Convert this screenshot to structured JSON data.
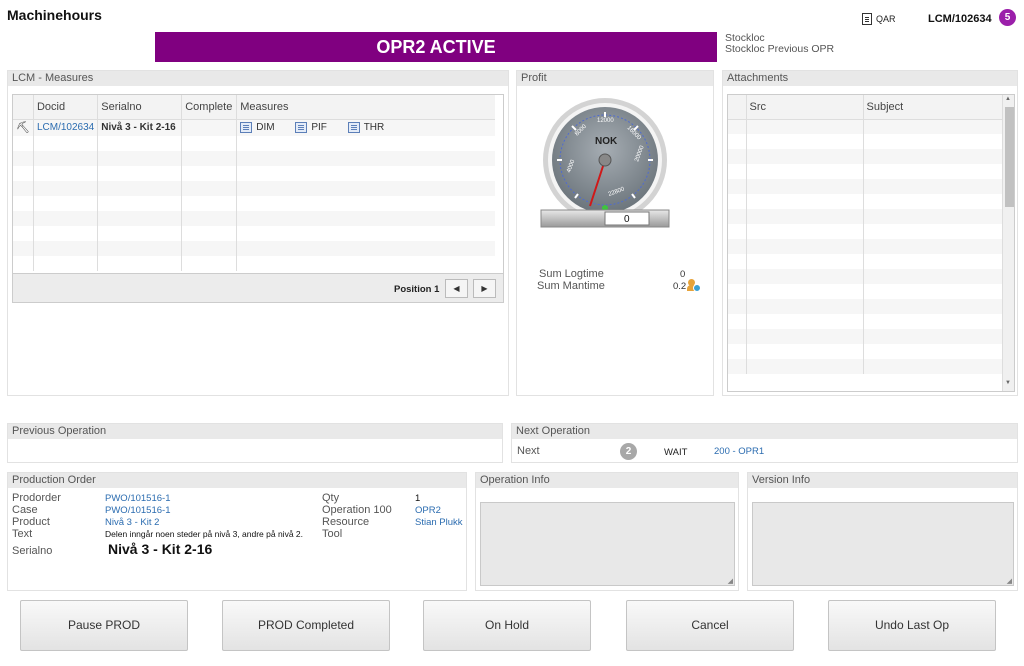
{
  "header": {
    "title": "Machinehours",
    "status_banner": "OPR2 ACTIVE",
    "banner_color": "#800080",
    "stockloc_label": "Stockloc",
    "stockloc_prev_label": "Stockloc Previous OPR",
    "qar_label": "QAR",
    "lcm_id": "LCM/102634",
    "lcm_badge": "5"
  },
  "lcm_measures": {
    "title": "LCM - Measures",
    "columns": [
      "Docid",
      "Serialno",
      "Complete",
      "Measures"
    ],
    "row": {
      "docid": "LCM/102634",
      "serialno": "Nivå 3 - Kit 2-16",
      "complete": "",
      "measures": [
        "DIM",
        "PIF",
        "THR"
      ]
    },
    "position_label": "Position 1",
    "prev_icon": "triangle-left",
    "next_icon": "triangle-right"
  },
  "profit": {
    "title": "Profit",
    "gauge_unit": "NOK",
    "gauge_ticks": [
      "4000",
      "8000",
      "12000",
      "16000",
      "20000",
      "22800"
    ],
    "gauge_readout": "0",
    "sum_logtime_label": "Sum Logtime",
    "sum_logtime_value": "0",
    "sum_mantime_label": "Sum Mantime",
    "sum_mantime_value": "0.2"
  },
  "attachments": {
    "title": "Attachments",
    "columns": [
      "Src",
      "Subject"
    ]
  },
  "previous_operation": {
    "title": "Previous Operation"
  },
  "next_operation": {
    "title": "Next Operation",
    "label": "Next",
    "badge": "2",
    "status": "WAIT",
    "operation": "200 - OPR1"
  },
  "production_order": {
    "title": "Production Order",
    "prodorder_label": "Prodorder",
    "prodorder_value": "PWO/101516-1",
    "case_label": "Case",
    "case_value": "PWO/101516-1",
    "product_label": "Product",
    "product_value": "Nivå 3 - Kit 2",
    "text_label": "Text",
    "text_value": "Delen inngår noen steder på nivå 3, andre på nivå 2.",
    "serialno_label": "Serialno",
    "serialno_value": "Nivå 3 - Kit 2-16",
    "qty_label": "Qty",
    "qty_value": "1",
    "operation_label": "Operation 100",
    "operation_value": "OPR2",
    "resource_label": "Resource",
    "resource_value": "Stian Plukk",
    "tool_label": "Tool",
    "tool_value": ""
  },
  "operation_info": {
    "title": "Operation Info"
  },
  "version_info": {
    "title": "Version Info"
  },
  "actions": {
    "pause": "Pause PROD",
    "completed": "PROD Completed",
    "on_hold": "On Hold",
    "cancel": "Cancel",
    "undo": "Undo Last Op"
  }
}
